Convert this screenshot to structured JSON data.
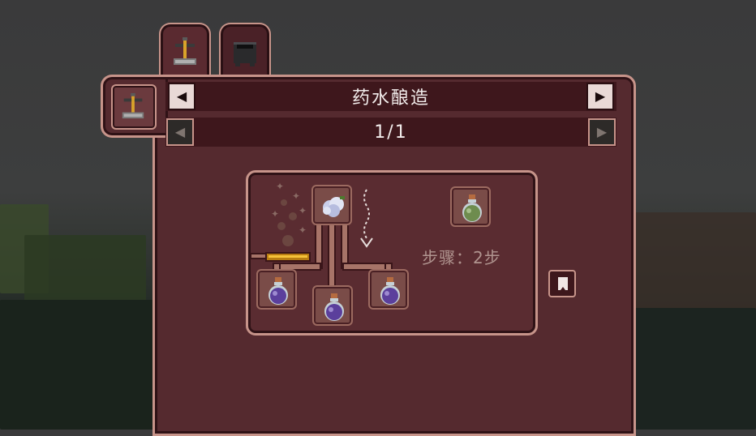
{
  "tabs": [
    {
      "id": "brewing-stand",
      "icon": "brewing-stand-icon",
      "active": true
    },
    {
      "id": "cauldron",
      "icon": "cauldron-icon",
      "active": false
    }
  ],
  "header": {
    "title": "药水酿造",
    "prev_label": "◀",
    "next_label": "▶"
  },
  "pager": {
    "page": "1/1",
    "prev_label": "◀",
    "next_label": "▶"
  },
  "recipe": {
    "ingredient": "cobweb-icon",
    "output": "green-potion-icon",
    "bottles": [
      "purple-potion-icon",
      "purple-potion-icon",
      "purple-potion-icon"
    ],
    "steps_text": "步骤：2步"
  },
  "colors": {
    "panel": "#552a2f",
    "border": "#c7948a",
    "bar": "#3e171c",
    "fuel": "#f5c23a",
    "potion_purple": "#5b3f9c",
    "potion_green": "#6e8c4e"
  }
}
